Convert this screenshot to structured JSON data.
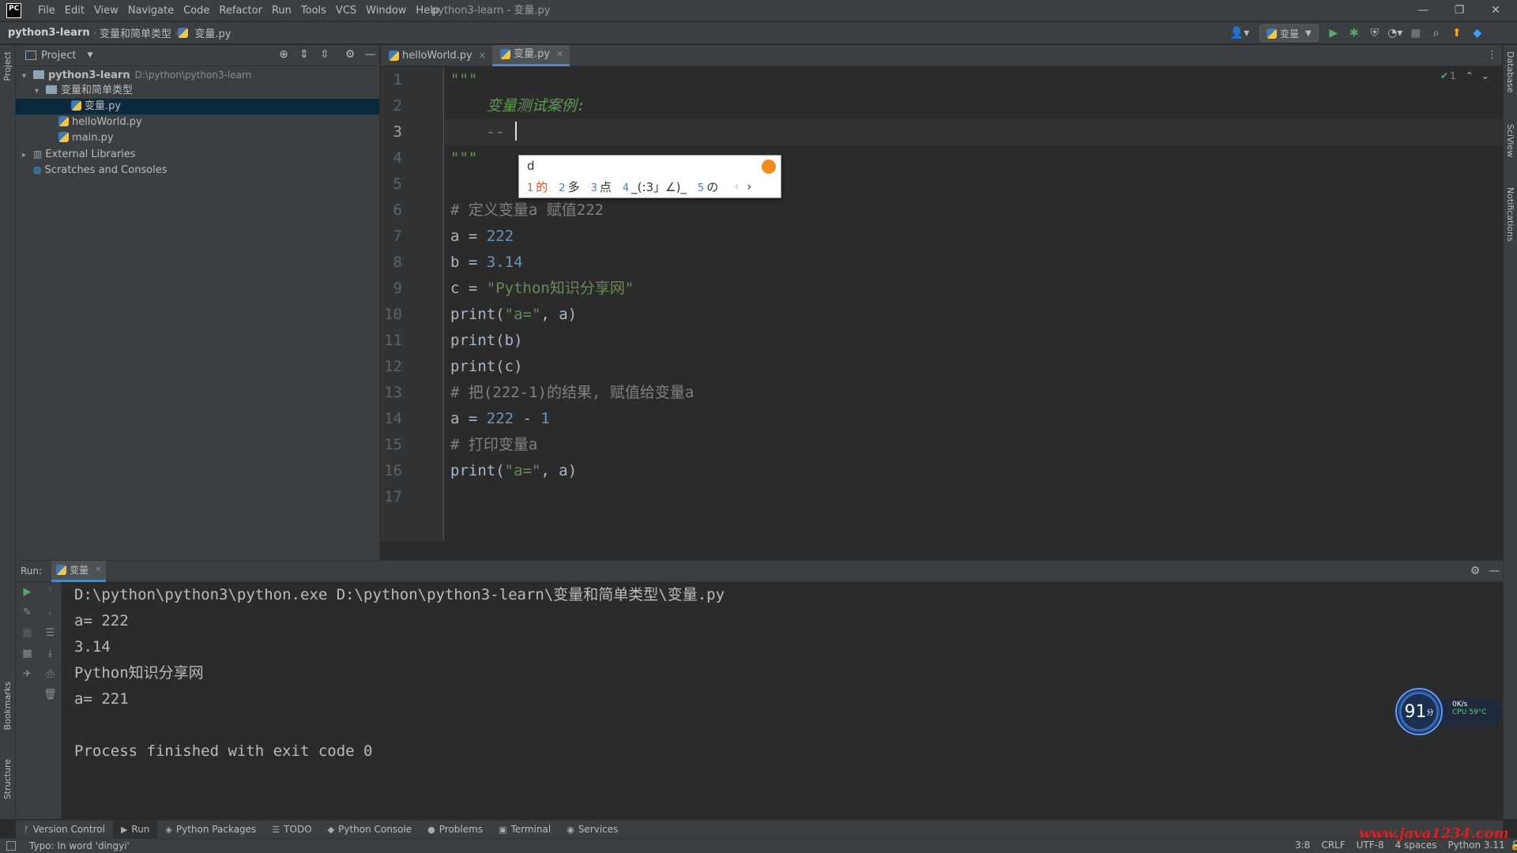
{
  "app": {
    "logo": "PC",
    "window_title": "python3-learn - 变量.py",
    "menu": [
      "File",
      "Edit",
      "View",
      "Navigate",
      "Code",
      "Refactor",
      "Run",
      "Tools",
      "VCS",
      "Window",
      "Help"
    ]
  },
  "breadcrumb": [
    "python3-learn",
    "变量和简单类型",
    "变量.py"
  ],
  "toolbar": {
    "run_config": "变量"
  },
  "left_strip": {
    "top": "Project",
    "bookmarks": "Bookmarks",
    "structure": "Structure"
  },
  "right_strip": {
    "database": "Database",
    "sciview": "SciView",
    "notifications": "Notifications"
  },
  "project": {
    "title": "Project",
    "tree": [
      {
        "label": "python3-learn",
        "hint": "D:\\python\\python3-learn",
        "type": "folder",
        "indent": 0,
        "arrow": "▾",
        "bold": true
      },
      {
        "label": "变量和简单类型",
        "type": "folder",
        "indent": 1,
        "arrow": "▾"
      },
      {
        "label": "变量.py",
        "type": "py",
        "indent": 3,
        "selected": true
      },
      {
        "label": "helloWorld.py",
        "type": "py",
        "indent": 2
      },
      {
        "label": "main.py",
        "type": "py",
        "indent": 2
      },
      {
        "label": "External Libraries",
        "type": "lib",
        "indent": 0,
        "arrow": "▸"
      },
      {
        "label": "Scratches and Consoles",
        "type": "scratch",
        "indent": 0
      }
    ]
  },
  "editor": {
    "tabs": [
      {
        "label": "helloWorld.py",
        "active": false
      },
      {
        "label": "变量.py",
        "active": true
      }
    ],
    "inspection_count": "1",
    "lines": [
      {
        "n": "1",
        "parts": [
          [
            "doc",
            "\"\"\""
          ]
        ]
      },
      {
        "n": "2",
        "parts": [
          [
            "doc",
            "    变量测试案例:"
          ]
        ]
      },
      {
        "n": "3",
        "parts": [
          [
            "doc",
            "    -- "
          ]
        ],
        "current": true
      },
      {
        "n": "4",
        "parts": [
          [
            "doc",
            "\"\"\""
          ]
        ]
      },
      {
        "n": "5",
        "parts": []
      },
      {
        "n": "6",
        "parts": [
          [
            "com",
            "# 定义变量a 赋值222"
          ]
        ]
      },
      {
        "n": "7",
        "parts": [
          [
            "txt",
            "a = "
          ],
          [
            "num",
            "222"
          ]
        ]
      },
      {
        "n": "8",
        "parts": [
          [
            "txt",
            "b = "
          ],
          [
            "num",
            "3.14"
          ]
        ]
      },
      {
        "n": "9",
        "parts": [
          [
            "txt",
            "c = "
          ],
          [
            "str",
            "\"Python知识分享网\""
          ]
        ]
      },
      {
        "n": "10",
        "parts": [
          [
            "txt",
            "print("
          ],
          [
            "str",
            "\"a=\""
          ],
          [
            "txt",
            ", a)"
          ]
        ]
      },
      {
        "n": "11",
        "parts": [
          [
            "txt",
            "print(b)"
          ]
        ]
      },
      {
        "n": "12",
        "parts": [
          [
            "txt",
            "print(c)"
          ]
        ]
      },
      {
        "n": "13",
        "parts": [
          [
            "com",
            "# 把(222-1)的结果, 赋值给变量a"
          ]
        ]
      },
      {
        "n": "14",
        "parts": [
          [
            "txt",
            "a = "
          ],
          [
            "num",
            "222"
          ],
          [
            "txt",
            " - "
          ],
          [
            "num",
            "1"
          ]
        ]
      },
      {
        "n": "15",
        "parts": [
          [
            "com",
            "# 打印变量a"
          ]
        ]
      },
      {
        "n": "16",
        "parts": [
          [
            "txt",
            "print("
          ],
          [
            "str",
            "\"a=\""
          ],
          [
            "txt",
            ", a)"
          ]
        ]
      },
      {
        "n": "17",
        "parts": []
      }
    ]
  },
  "ime": {
    "input": "d",
    "candidates": [
      {
        "n": "1",
        "text": "的"
      },
      {
        "n": "2",
        "text": "多"
      },
      {
        "n": "3",
        "text": "点"
      },
      {
        "n": "4",
        "text": "_(:3」∠)_"
      },
      {
        "n": "5",
        "text": "の"
      }
    ],
    "prev": "‹",
    "next": "›"
  },
  "run": {
    "label": "Run:",
    "tab": "变量",
    "output": [
      "D:\\python\\python3\\python.exe D:\\python\\python3-learn\\变量和简单类型\\变量.py",
      "a= 222",
      "3.14",
      "Python知识分享网",
      "a= 221",
      "",
      "Process finished with exit code 0"
    ]
  },
  "perf_widget": {
    "score": "91",
    "unit": "分",
    "net": "0K/s",
    "cpu": "CPU 59°C"
  },
  "tool_tabs": [
    {
      "icon": "ᚠ",
      "label": "Version Control",
      "name": "version-control"
    },
    {
      "icon": "▶",
      "label": "Run",
      "name": "run"
    },
    {
      "icon": "◈",
      "label": "Python Packages",
      "name": "python-packages"
    },
    {
      "icon": "☰",
      "label": "TODO",
      "name": "todo"
    },
    {
      "icon": "◆",
      "label": "Python Console",
      "name": "python-console"
    },
    {
      "icon": "●",
      "label": "Problems",
      "name": "problems"
    },
    {
      "icon": "▣",
      "label": "Terminal",
      "name": "terminal"
    },
    {
      "icon": "◉",
      "label": "Services",
      "name": "services"
    }
  ],
  "status": {
    "message": "Typo: In word 'dingyi'",
    "position": "3:8",
    "line_sep": "CRLF",
    "encoding": "UTF-8",
    "indent": "4 spaces",
    "interpreter": "Python 3.11"
  },
  "watermark": "www.java1234.com",
  "colors": {
    "accent": "#4a88c7",
    "selection": "#0d293e",
    "run_green": "#59a869"
  }
}
